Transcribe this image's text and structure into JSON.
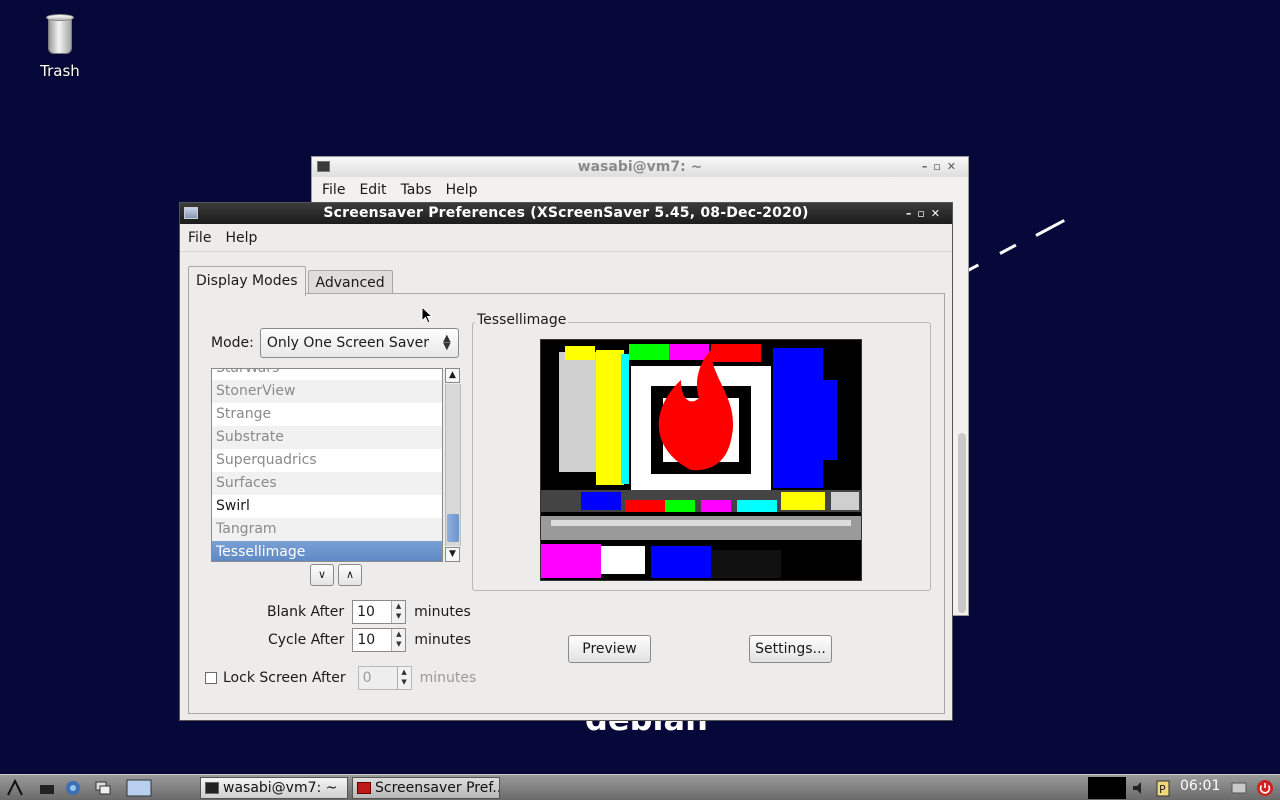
{
  "desktop": {
    "trash_label": "Trash",
    "background_text": "debian"
  },
  "terminal": {
    "title": "wasabi@vm7: ~",
    "menu": [
      "File",
      "Edit",
      "Tabs",
      "Help"
    ]
  },
  "dialog": {
    "title": "Screensaver Preferences  (XScreenSaver 5.45, 08-Dec-2020)",
    "menu": [
      "File",
      "Help"
    ],
    "tabs": [
      "Display Modes",
      "Advanced"
    ],
    "active_tab": "Display Modes",
    "mode_label": "Mode:",
    "mode_value": "Only One Screen Saver",
    "list_items": [
      {
        "name": "StarWars",
        "enabled": false
      },
      {
        "name": "StonerView",
        "enabled": false
      },
      {
        "name": "Strange",
        "enabled": false
      },
      {
        "name": "Substrate",
        "enabled": false
      },
      {
        "name": "Superquadrics",
        "enabled": false
      },
      {
        "name": "Surfaces",
        "enabled": false
      },
      {
        "name": "Swirl",
        "enabled": true
      },
      {
        "name": "Tangram",
        "enabled": false
      },
      {
        "name": "Tessellimage",
        "enabled": false,
        "selected": true
      }
    ],
    "blank_after_label": "Blank After",
    "blank_after_value": "10",
    "cycle_after_label": "Cycle After",
    "cycle_after_value": "10",
    "lock_label": "Lock Screen After",
    "lock_value": "0",
    "unit": "minutes",
    "preview_frame_label": "Tessellimage",
    "preview_button": "Preview",
    "settings_button": "Settings..."
  },
  "taskbar": {
    "tasks": [
      "wasabi@vm7: ~",
      "Screensaver Pref..."
    ],
    "clock": "06:01"
  }
}
